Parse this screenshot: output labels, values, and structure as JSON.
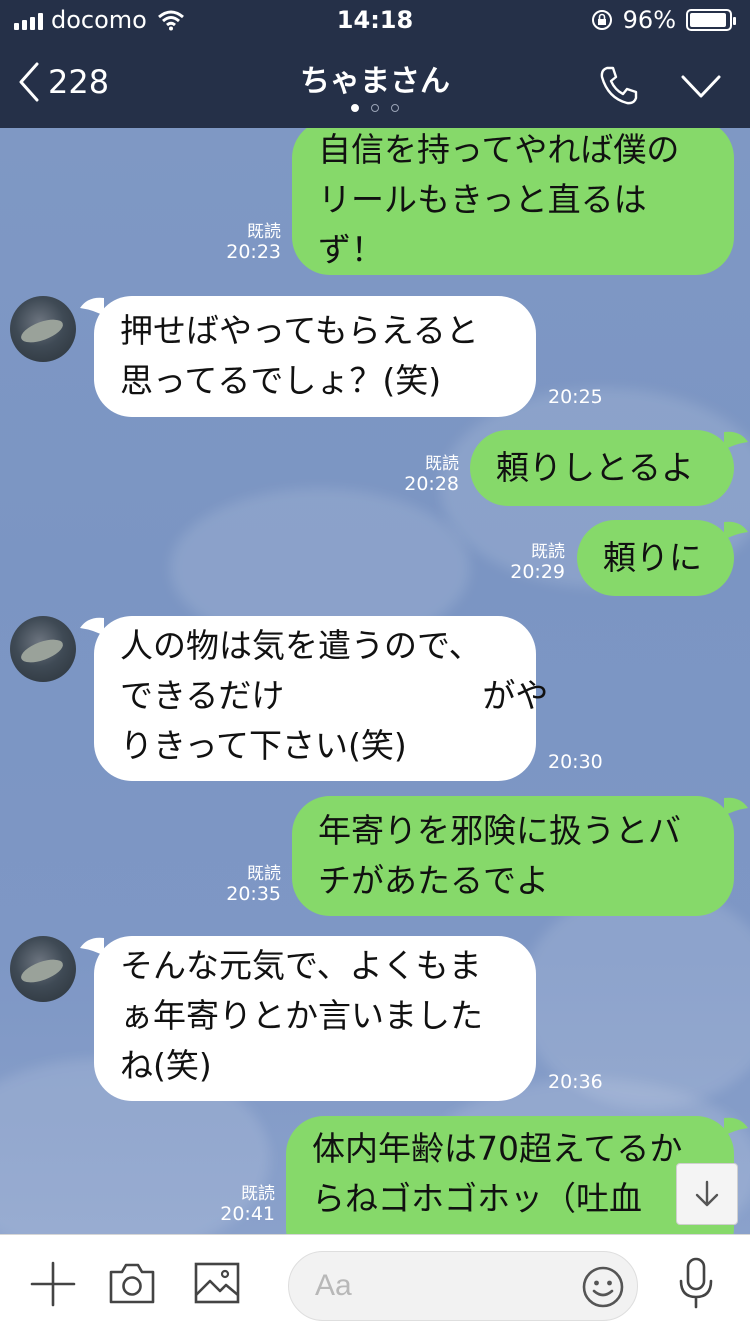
{
  "status": {
    "carrier": "docomo",
    "time": "14:18",
    "battery": "96%",
    "battery_level": 0.96
  },
  "header": {
    "back_count": "228",
    "title": "ちゃまさん",
    "page_dots": 3,
    "active_dot": 0
  },
  "messages": [
    {
      "sender": "me",
      "text": "自信を持ってやれば僕の\nリールもきっと直るは\nず！",
      "read": "既読",
      "time": "20:23"
    },
    {
      "sender": "them",
      "text": "押せばやってもらえると\n思ってるでしょ？(笑)",
      "time": "20:25"
    },
    {
      "sender": "me",
      "text": "頼りしとるよ",
      "read": "既読",
      "time": "20:28"
    },
    {
      "sender": "me",
      "text": "頼りに",
      "read": "既読",
      "time": "20:29"
    },
    {
      "sender": "them",
      "text": "人の物は気を遣うので、\nできるだけ　　　　　　がや\nりきって下さい(笑)",
      "time": "20:30"
    },
    {
      "sender": "me",
      "text": "年寄りを邪険に扱うとバ\nチがあたるでよ",
      "read": "既読",
      "time": "20:35"
    },
    {
      "sender": "them",
      "text": "そんな元気で、よくもま\nぁ年寄りとか言いました\nね(笑)",
      "time": "20:36"
    },
    {
      "sender": "me",
      "text": "体内年齢は70超えてるか\nらねゴホゴホッ（吐血",
      "read": "既読",
      "time": "20:41"
    }
  ],
  "input": {
    "placeholder": "Aa",
    "value": ""
  },
  "icons": {
    "add": "plus-icon",
    "camera": "camera-icon",
    "image": "image-icon",
    "emoji": "emoji-icon",
    "mic": "microphone-icon",
    "scroll": "arrow-down-icon"
  },
  "colors": {
    "header_bg": "#253048",
    "my_bubble": "#86d96a",
    "their_bubble": "#ffffff",
    "chat_bg": "#7d97c4"
  }
}
